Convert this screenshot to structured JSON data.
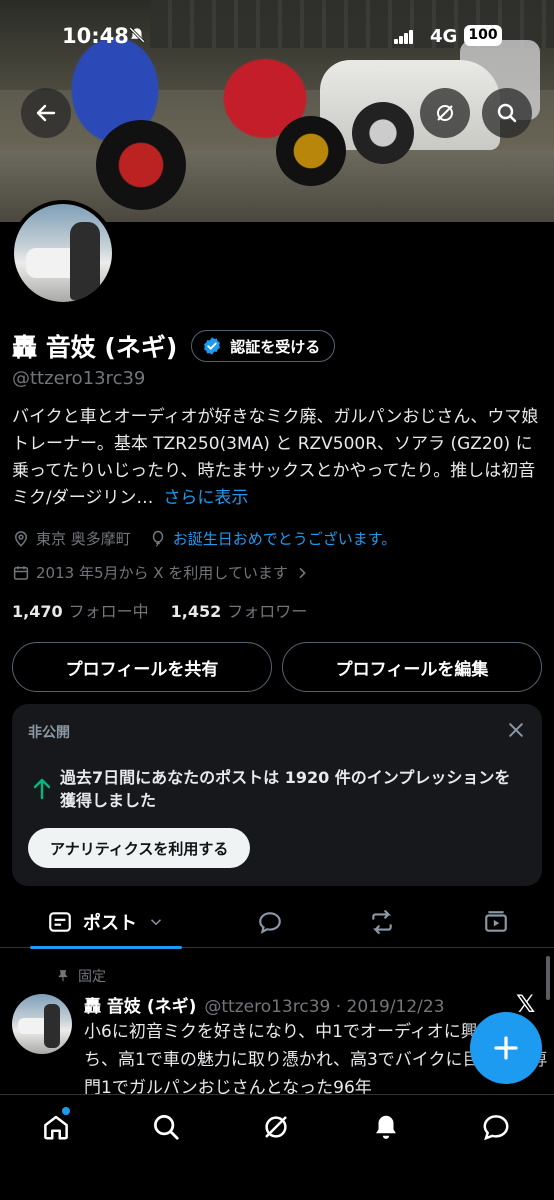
{
  "status_bar": {
    "time": "10:48",
    "network": "4G",
    "battery": "100"
  },
  "profile": {
    "name": "轟 音妓 (ネギ)",
    "verify_label": "認証を受ける",
    "handle": "@ttzero13rc39",
    "bio": "バイクと車とオーディオが好きなミク廃、ガルパンおじさん、ウマ娘トレーナー。基本 TZR250(3MA) と RZV500R、ソアラ (GZ20) に乗ってたりいじったり、時たまサックスとかやってたり。推しは初音ミク/ダージリン…",
    "bio_more": "さらに表示",
    "location": "東京 奥多摩町",
    "birthday": "お誕生日おめでとうございます。",
    "joined": "2013 年5月から X を利用しています",
    "following_count": "1,470",
    "following_label": "フォロー中",
    "followers_count": "1,452",
    "followers_label": "フォロワー"
  },
  "actions": {
    "share": "プロフィールを共有",
    "edit": "プロフィールを編集"
  },
  "card": {
    "label": "非公開",
    "message": "過去7日間にあなたのポストは 1920 件のインプレッションを獲得しました",
    "button": "アナリティクスを利用する"
  },
  "tabs": {
    "posts": "ポスト"
  },
  "pinned_post": {
    "pinned_label": "固定",
    "name": "轟 音妓 (ネギ)",
    "handle_date": "@ttzero13rc39 · 2019/12/23",
    "text": "小6に初音ミクを好きになり、中1でオーディオに興味を持ち、高1で車の魅力に取り憑かれ、高3でバイクに目覚め、専門1でガルパンおじさんとなった96年"
  },
  "colors": {
    "accent": "#1d9bf0",
    "background": "#000000",
    "muted": "#71767b",
    "card": "#16181c"
  }
}
